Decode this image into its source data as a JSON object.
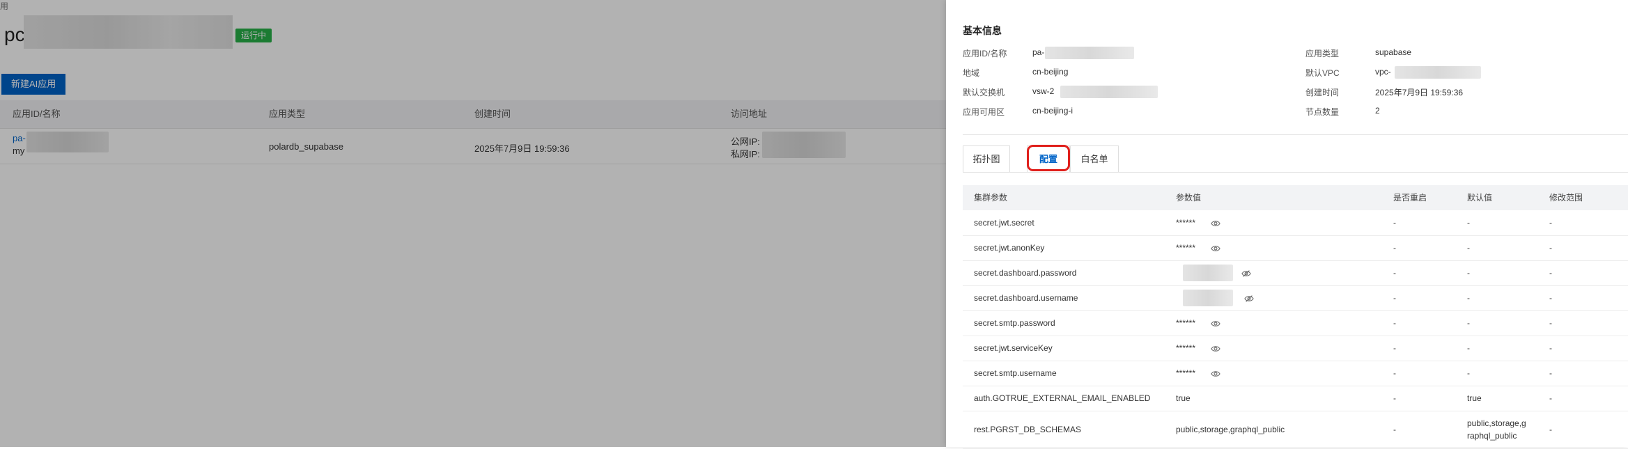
{
  "page": {
    "crumb": "用",
    "title_prefix": "pc",
    "status": "运行中",
    "create_button": "新建AI应用",
    "table": {
      "headers": [
        "应用ID/名称",
        "应用类型",
        "创建时间",
        "访问地址"
      ],
      "row": {
        "id_prefix": "pa-",
        "name_prefix": "my",
        "type": "polardb_supabase",
        "created": "2025年7月9日 19:59:36",
        "public_ip_label": "公网IP:",
        "private_ip_label": "私网IP:"
      }
    }
  },
  "drawer": {
    "section_title": "基本信息",
    "info_left": [
      {
        "label": "应用ID/名称",
        "value": "pa-"
      },
      {
        "label": "地域",
        "value": "cn-beijing"
      },
      {
        "label": "默认交换机",
        "value": "vsw-2"
      },
      {
        "label": "应用可用区",
        "value": "cn-beijing-i"
      }
    ],
    "info_right": [
      {
        "label": "应用类型",
        "value": "supabase"
      },
      {
        "label": "默认VPC",
        "value": "vpc-"
      },
      {
        "label": "创建时间",
        "value": "2025年7月9日 19:59:36"
      },
      {
        "label": "节点数量",
        "value": "2"
      }
    ],
    "tabs": [
      {
        "label": "拓扑图"
      },
      {
        "label": "配置"
      },
      {
        "label": "白名单"
      }
    ],
    "param_table": {
      "headers": [
        "集群参数",
        "参数值",
        "是否重启",
        "默认值",
        "修改范围"
      ],
      "rows": [
        {
          "param": "secret.jwt.secret",
          "value": "******",
          "restart": "-",
          "default": "-",
          "range": "-"
        },
        {
          "param": "secret.jwt.anonKey",
          "value": "******",
          "restart": "-",
          "default": "-",
          "range": "-"
        },
        {
          "param": "secret.dashboard.password",
          "value": "",
          "restart": "-",
          "default": "-",
          "range": "-"
        },
        {
          "param": "secret.dashboard.username",
          "value": "",
          "restart": "-",
          "default": "-",
          "range": "-"
        },
        {
          "param": "secret.smtp.password",
          "value": "******",
          "restart": "-",
          "default": "-",
          "range": "-"
        },
        {
          "param": "secret.jwt.serviceKey",
          "value": "******",
          "restart": "-",
          "default": "-",
          "range": "-"
        },
        {
          "param": "secret.smtp.username",
          "value": "******",
          "restart": "-",
          "default": "-",
          "range": "-"
        },
        {
          "param": "auth.GOTRUE_EXTERNAL_EMAIL_ENABLED",
          "value": "true",
          "restart": "-",
          "default": "true",
          "range": "-"
        },
        {
          "param": "rest.PGRST_DB_SCHEMAS",
          "value": "public,storage,graphql_public",
          "restart": "-",
          "default": "public,storage,g",
          "default_line2": "raphql_public",
          "range": "-"
        }
      ]
    }
  },
  "colors": {
    "primary": "#0064c8",
    "status_green": "#27b148",
    "highlight_red": "#e0201c"
  }
}
